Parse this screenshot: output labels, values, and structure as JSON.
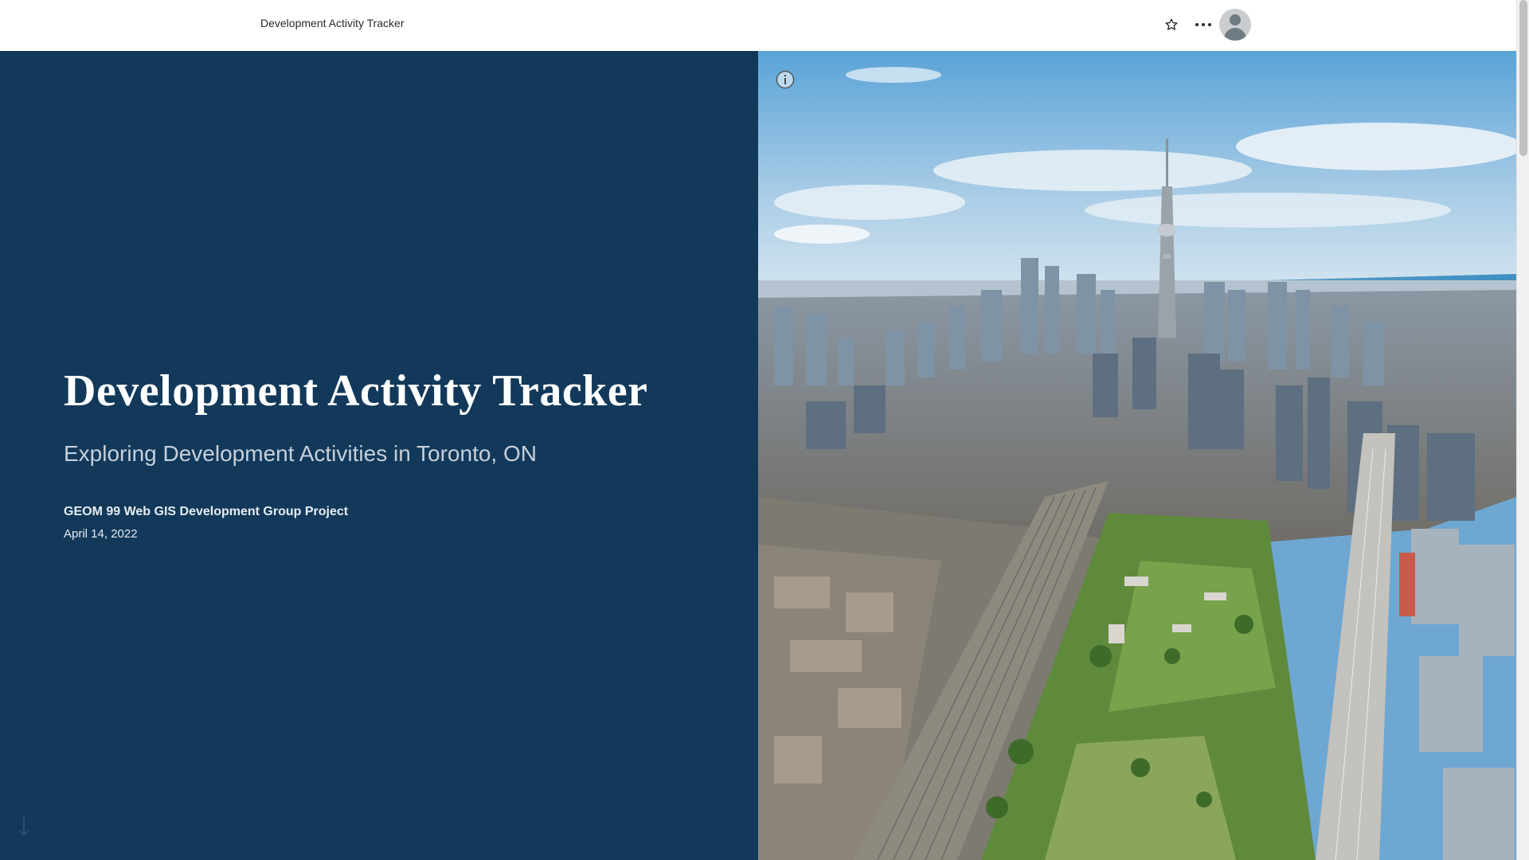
{
  "header": {
    "title": "Development Activity Tracker",
    "favorite_icon": "star-icon",
    "more_icon": "ellipsis-icon",
    "avatar_icon": "user-avatar-icon"
  },
  "cover": {
    "title": "Development Activity Tracker",
    "subtitle": "Exploring Development Activities in Toronto, ON",
    "byline": "GEOM 99 Web GIS Development Group Project",
    "date": "April 14, 2022",
    "background_color": "#12395a",
    "scroll_icon": "arrow-down-icon"
  },
  "media": {
    "info_icon": "info-icon",
    "scene": "aerial-city-skyline-photo"
  }
}
